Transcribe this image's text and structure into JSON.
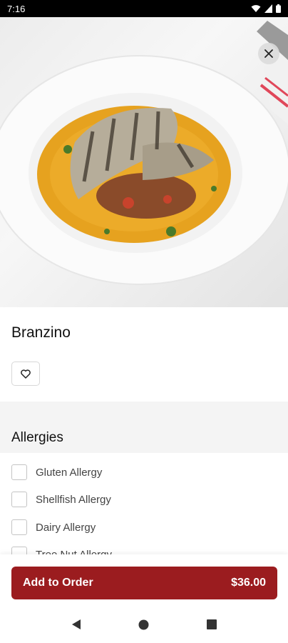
{
  "status_bar": {
    "time": "7:16",
    "icons": [
      "wifi-icon",
      "cell-signal-icon",
      "battery-icon"
    ]
  },
  "hero": {
    "image_subject": "grilled branzino fillet in saffron broth on white plate",
    "close_icon": "close-icon"
  },
  "item": {
    "title": "Branzino",
    "favorite_icon": "heart-outline-icon"
  },
  "allergies": {
    "title": "Allergies",
    "options": [
      {
        "label": "Gluten Allergy",
        "checked": false
      },
      {
        "label": "Shellfish Allergy",
        "checked": false
      },
      {
        "label": "Dairy Allergy",
        "checked": false
      },
      {
        "label": "Tree Nut Allergy",
        "checked": false
      }
    ]
  },
  "order": {
    "label": "Add to Order",
    "price": "$36.00"
  },
  "colors": {
    "accent": "#9b1c1f",
    "status_bar": "#000000",
    "section_bg": "#f4f4f4"
  },
  "nav": {
    "back": "back-triangle-icon",
    "home": "home-circle-icon",
    "recents": "recents-square-icon"
  }
}
